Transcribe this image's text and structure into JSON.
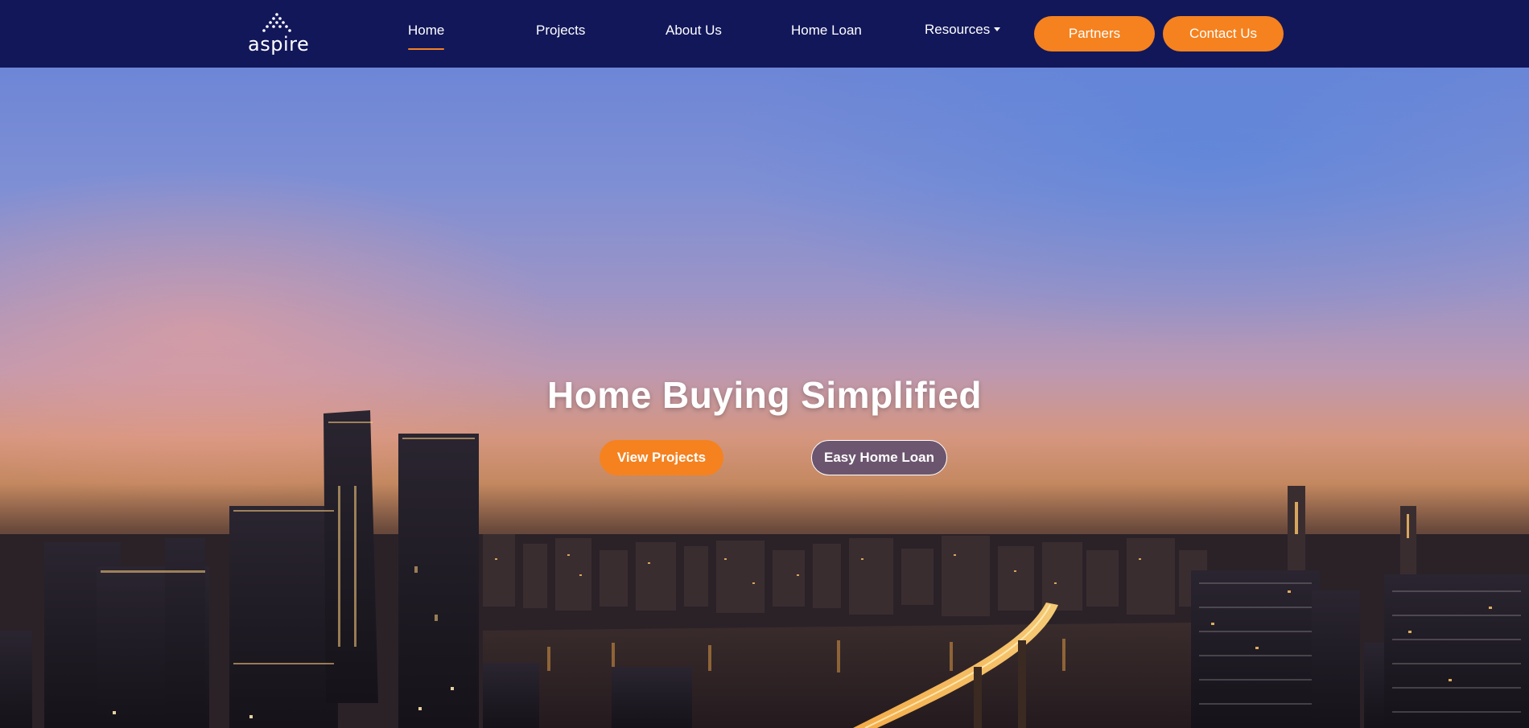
{
  "brand": {
    "name": "aspire"
  },
  "nav": {
    "items": [
      {
        "label": "Home",
        "active": true
      },
      {
        "label": "Projects"
      },
      {
        "label": "About Us"
      },
      {
        "label": "Home Loan"
      },
      {
        "label": "Resources"
      }
    ],
    "partners_label": "Partners",
    "contact_label": "Contact Us"
  },
  "hero": {
    "title": "Home Buying Simplified",
    "primary_cta": "View Projects",
    "secondary_cta": "Easy Home Loan",
    "background": "city-skyline-at-sunset"
  },
  "colors": {
    "navbar_bg": "#12175a",
    "accent": "#f5821f",
    "text": "#ffffff"
  }
}
